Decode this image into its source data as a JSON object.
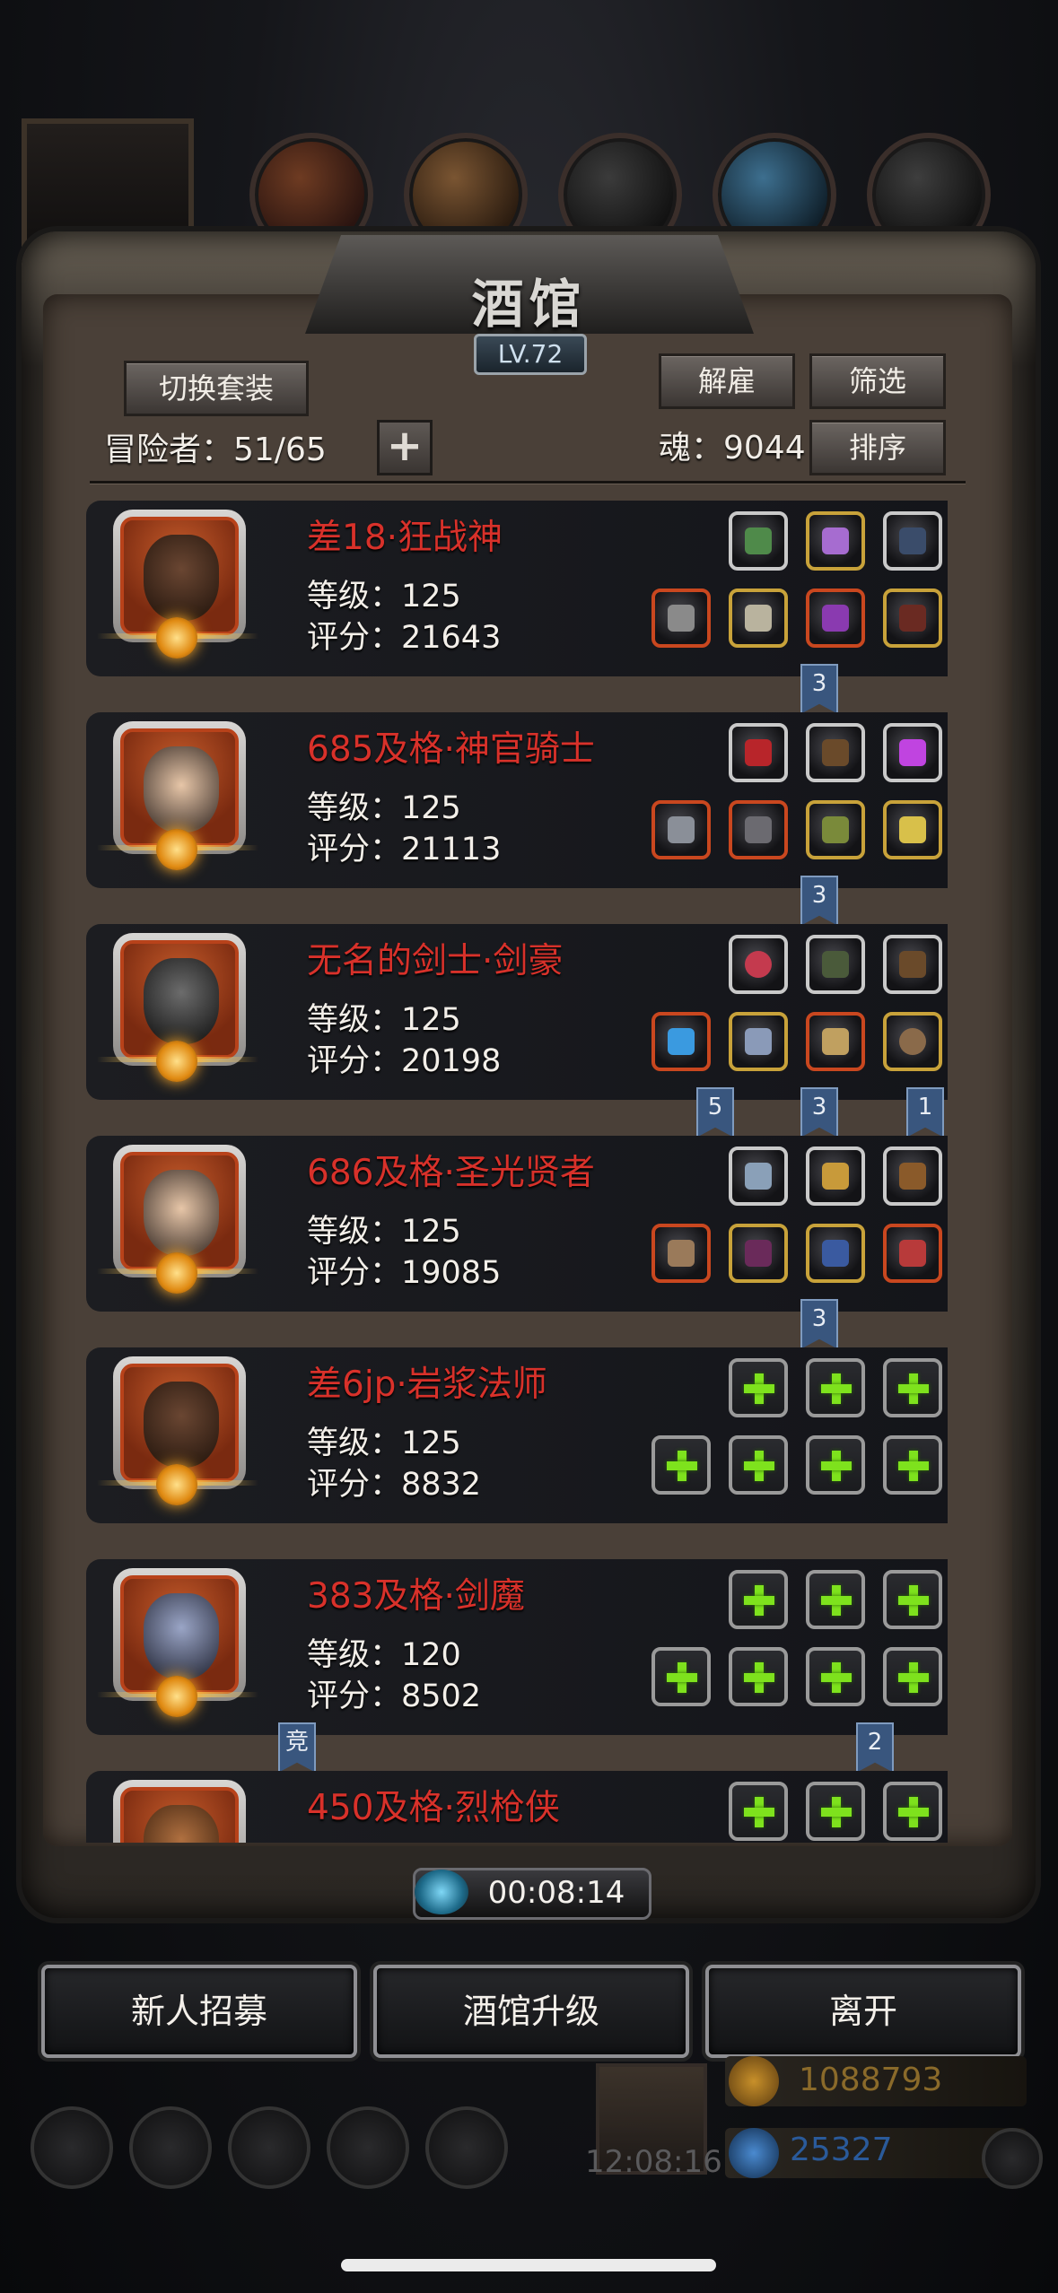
{
  "panel": {
    "title": "酒馆",
    "level": "LV.72",
    "switch_set_label": "切换套装",
    "dismiss_label": "解雇",
    "filter_label": "筛选",
    "sort_label": "排序",
    "adventurers_label": "冒险者：51/65",
    "soul_label": "魂：9044"
  },
  "heroes": [
    {
      "name": "差18·狂战神",
      "level": "等级：125",
      "score": "评分：21643",
      "face": "dark"
    },
    {
      "name": "685及格·神官骑士",
      "level": "等级：125",
      "score": "评分：21113",
      "face": "hood"
    },
    {
      "name": "无名的剑士·剑豪",
      "level": "等级：125",
      "score": "评分：20198",
      "face": "helm"
    },
    {
      "name": "686及格·圣光贤者",
      "level": "等级：125",
      "score": "评分：19085",
      "face": "hood"
    },
    {
      "name": "差6jp·岩浆法师",
      "level": "等级：125",
      "score": "评分：8832",
      "face": "dark"
    },
    {
      "name": "383及格·剑魔",
      "level": "等级：120",
      "score": "评分：8502",
      "face": "pale"
    },
    {
      "name": "450及格·烈枪侠",
      "level": "",
      "score": "",
      "face": "hat"
    }
  ],
  "flags": {
    "f1": "3",
    "f2": "3",
    "f3a": "5",
    "f3b": "3",
    "f3c": "1",
    "f4": "3",
    "f6a": "竞",
    "f6b": "2"
  },
  "timer": "00:08:14",
  "bottom_buttons": {
    "recruit": "新人招募",
    "upgrade": "酒馆升级",
    "leave": "离开"
  },
  "background": {
    "clock": "12:08:16",
    "gold": "1088793",
    "gems": "25327"
  },
  "colors": {
    "hero_name": "#d8312a",
    "add_slot": "#7ee21d"
  }
}
